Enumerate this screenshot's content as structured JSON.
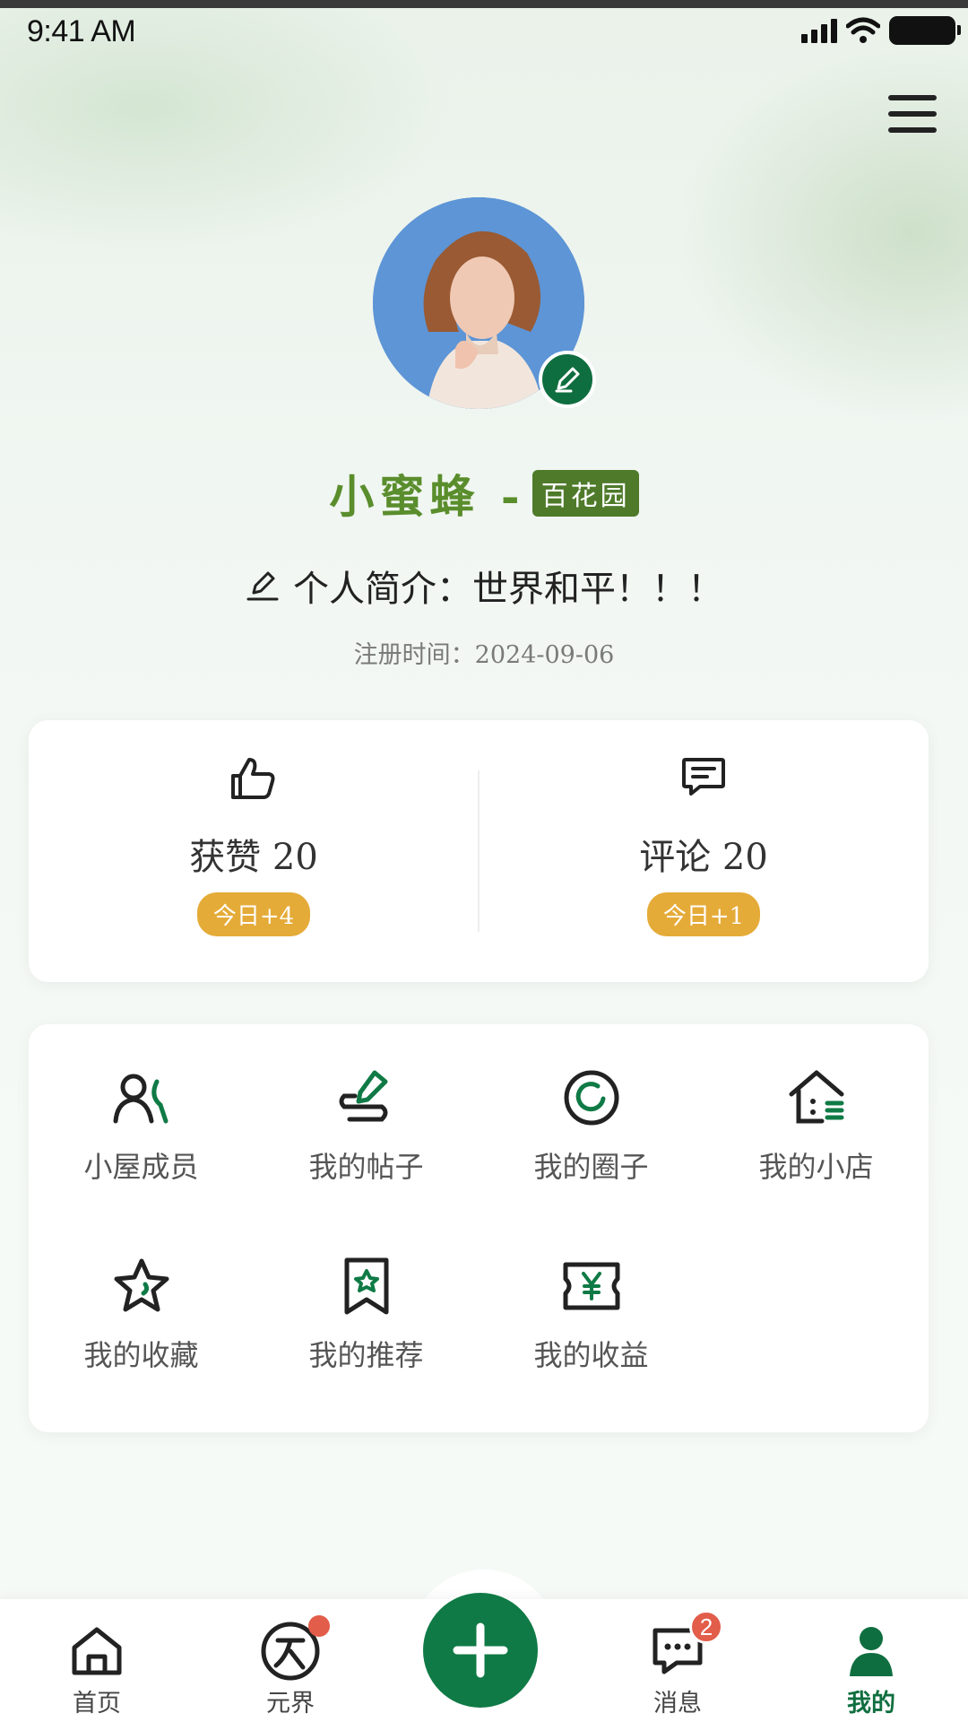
{
  "status": {
    "time": "9:41 AM"
  },
  "profile": {
    "nickname": "小蜜蜂 -",
    "tag": "百花园",
    "bio": "个人简介：世界和平！！！",
    "register": "注册时间：2024-09-06"
  },
  "stats": [
    {
      "label": "获赞 20",
      "today": "今日+4"
    },
    {
      "label": "评论 20",
      "today": "今日+1"
    }
  ],
  "menu": [
    {
      "label": "小屋成员",
      "icon": "members-icon"
    },
    {
      "label": "我的帖子",
      "icon": "post-icon"
    },
    {
      "label": "我的圈子",
      "icon": "circle-icon"
    },
    {
      "label": "我的小店",
      "icon": "shop-icon"
    },
    {
      "label": "我的收藏",
      "icon": "star-icon"
    },
    {
      "label": "我的推荐",
      "icon": "bookmark-icon"
    },
    {
      "label": "我的收益",
      "icon": "ticket-icon"
    }
  ],
  "tabs": [
    {
      "label": "首页",
      "icon": "home-icon"
    },
    {
      "label": "元界",
      "icon": "yuanjie-icon"
    },
    {
      "label": "消息",
      "icon": "message-icon",
      "badge": "2"
    },
    {
      "label": "我的",
      "icon": "user-icon"
    }
  ],
  "colors": {
    "brand": "#0f6e3f",
    "nickname": "#5a8d2c",
    "badge": "#e5ab38",
    "notify": "#e25d4a"
  }
}
